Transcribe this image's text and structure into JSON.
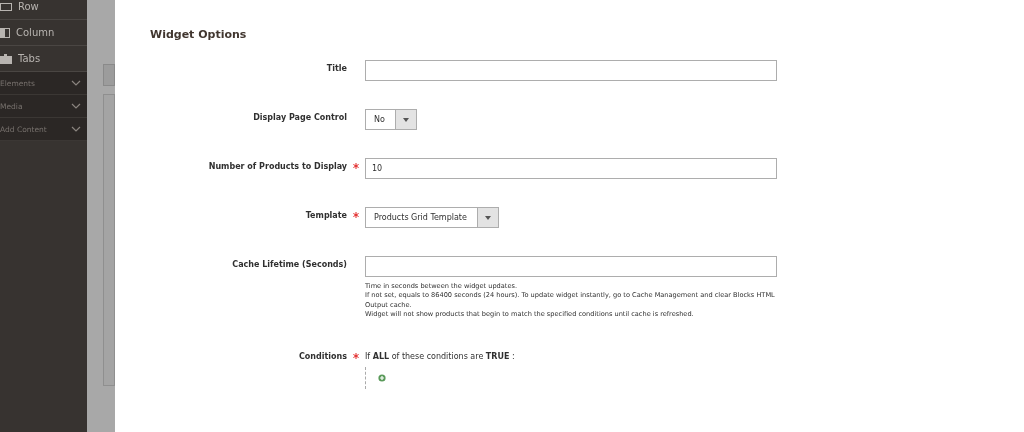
{
  "sidebar": {
    "items": [
      {
        "label": "Row",
        "kind": "row"
      },
      {
        "label": "Column",
        "kind": "column"
      },
      {
        "label": "Tabs",
        "kind": "tabs"
      }
    ],
    "sections": [
      {
        "label": "Elements",
        "expanded": false
      },
      {
        "label": "Media",
        "expanded": false
      },
      {
        "label": "Add Content",
        "expanded": false
      }
    ]
  },
  "modal": {
    "heading": "Widget Options",
    "fields": [
      {
        "kind": "text",
        "label": "Title",
        "required": false
      },
      {
        "kind": "select",
        "label": "Display Page Control",
        "required": false,
        "value": "No"
      },
      {
        "kind": "text",
        "label": "Number of Products to Display",
        "required": true,
        "value": "10"
      },
      {
        "kind": "select",
        "label": "Template",
        "required": true,
        "value": "Products Grid Template"
      },
      {
        "kind": "text",
        "label": "Cache Lifetime (Seconds)",
        "required": false,
        "note": [
          "Time in seconds between the widget updates.",
          "If not set, equals to 86400 seconds (24 hours). To update widget instantly, go to Cache Management and clear Blocks HTML Output cache.",
          "Widget will not show products that begin to match the specified conditions until cache is refreshed."
        ]
      },
      {
        "kind": "conditions",
        "label": "Conditions",
        "required": true,
        "value": "If **ALL**  of these conditions are **TRUE** :"
      }
    ]
  }
}
